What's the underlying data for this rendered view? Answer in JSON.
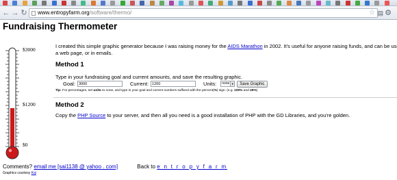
{
  "browser": {
    "url_host": "www.entropyfarm.org",
    "url_path": "/software/thermo/",
    "nav_back_glyph": "←",
    "nav_forward_glyph": "→",
    "reload_glyph": "↻",
    "star_glyph": "☆",
    "page_menu_glyph": "▤",
    "wrench_glyph": "⚙",
    "bookmark_colors": [
      "#d44",
      "#4a7fd4",
      "#e8a33a",
      "#5aa05a",
      "#777",
      "#3a6fcf",
      "#c33",
      "#888",
      "#4b8",
      "#d73",
      "#57c",
      "#999",
      "#3a3",
      "#c55",
      "#46a",
      "#b84",
      "#6a6",
      "#a4a",
      "#5bd",
      "#999",
      "#d55",
      "#4a7",
      "#c93",
      "#59c",
      "#777",
      "#3a6fcf",
      "#c44",
      "#888",
      "#5a5",
      "#d84",
      "#47b",
      "#999",
      "#b4b",
      "#6bc",
      "#777",
      "#c33",
      "#4a4",
      "#37c",
      "#999",
      "#e55"
    ]
  },
  "page": {
    "title": "Fundraising Thermometer",
    "intro_before": "I created this simple graphic generator because I was raising money for the ",
    "intro_link": "AIDS Marathon",
    "intro_after": " in 2002. It's useful for anyone raising funds, and can be used on a web page, or in emails.",
    "method1": {
      "heading": "Method 1",
      "description": "Type in your fundraising goal and current amounts, and save the resulting graphic.",
      "goal_label": "Goal:",
      "goal_value": "3000",
      "current_label": "Current:",
      "current_value": "1200",
      "units_label": "Units:",
      "units_value": "none",
      "save_button": "Save Graphic",
      "tip_prefix": "Tip:",
      "tip_text_1": " For percentages, set ",
      "tip_units": "units",
      "tip_text_2": " to none, and type in your goal and current numbers suffixed with the percent(",
      "tip_pct": "%",
      "tip_text_3": ") sign. (e.g. ",
      "tip_ex1": "100%",
      "tip_text_4": " and ",
      "tip_ex2": "25%",
      "tip_text_5": ")"
    },
    "method2": {
      "heading": "Method 2",
      "desc_before": "Copy the ",
      "desc_link": "PHP Source",
      "desc_after": " to your server, and then all you need is a good installation of PHP with the GD Libraries, and you're golden."
    },
    "footer": {
      "comments_label": "Comments?",
      "email_link": "email me [sai1138 @ yahoo . com]",
      "back_label": "Back to",
      "back_link": "e n t r o p y f a r m",
      "credit_label": "Graphics courtesy",
      "credit_link": "Kai"
    }
  },
  "thermometer": {
    "goal_label": "$3000",
    "current_label": "$1200",
    "zero_label": "$0",
    "goal": 3000,
    "current": 1200,
    "fill_color": "#cc1a1a",
    "tube_color": "#ffffff",
    "outline_color": "#333333"
  }
}
